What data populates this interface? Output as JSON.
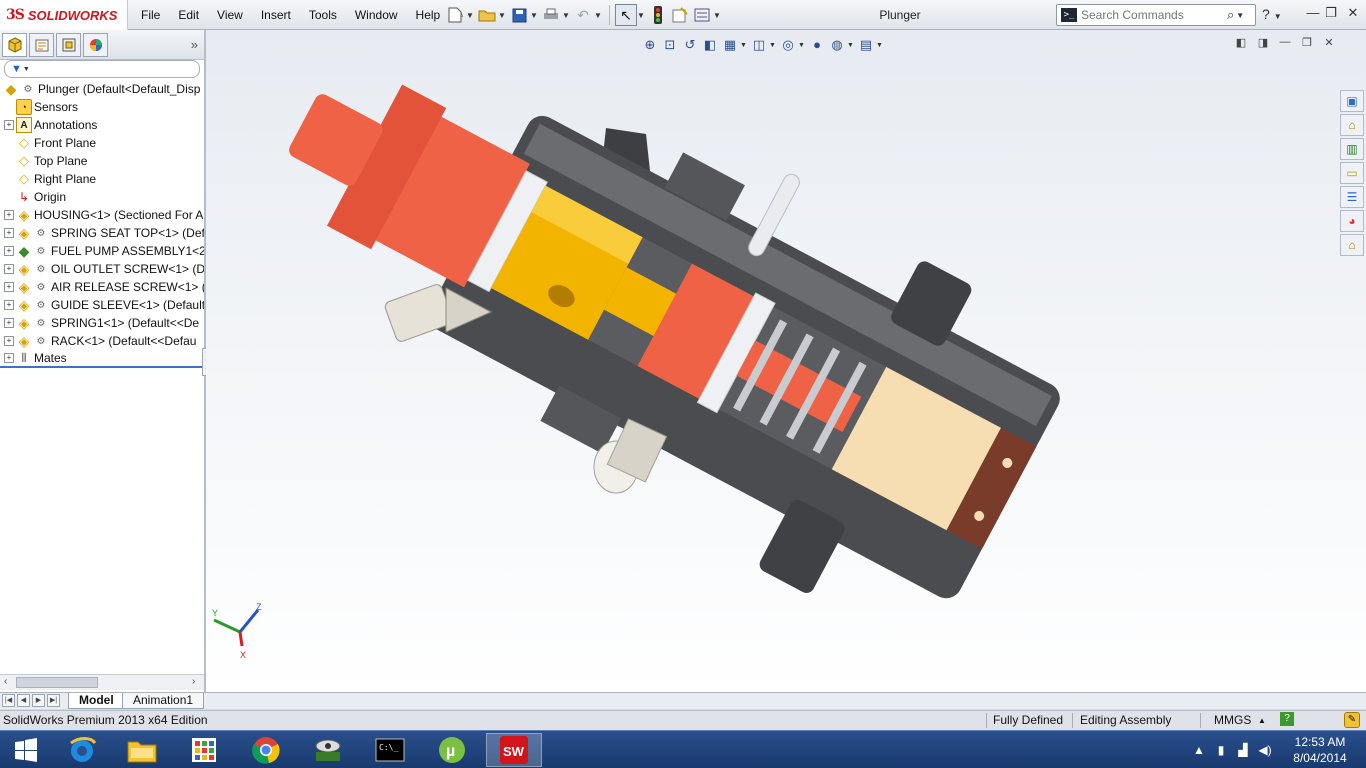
{
  "app": {
    "logo_mark": "3S",
    "logo_text": "SOLIDWORKS",
    "document_title": "Plunger"
  },
  "menus": [
    "File",
    "Edit",
    "View",
    "Insert",
    "Tools",
    "Window",
    "Help"
  ],
  "search": {
    "placeholder": "Search Commands",
    "value": ""
  },
  "feature_tree": {
    "filter_icon": "funnel-icon",
    "items": [
      {
        "label": "Plunger  (Default<Default_Disp",
        "icon": "assembly-icon",
        "level": 0
      },
      {
        "label": "Sensors",
        "icon": "sensor-icon",
        "level": 1,
        "expandable": false
      },
      {
        "label": "Annotations",
        "icon": "annotation-icon",
        "level": 1,
        "expandable": true
      },
      {
        "label": "Front Plane",
        "icon": "plane-icon",
        "level": 1,
        "expandable": false
      },
      {
        "label": "Top Plane",
        "icon": "plane-icon",
        "level": 1,
        "expandable": false
      },
      {
        "label": "Right Plane",
        "icon": "plane-icon",
        "level": 1,
        "expandable": false
      },
      {
        "label": "Origin",
        "icon": "origin-icon",
        "level": 1,
        "expandable": false
      },
      {
        "label": "HOUSING<1> (Sectioned For A",
        "icon": "part-icon",
        "level": 1,
        "expandable": true
      },
      {
        "label": "SPRING SEAT TOP<1> (Def",
        "icon": "part-icon",
        "level": 1,
        "expandable": true
      },
      {
        "label": "FUEL PUMP ASSEMBLY1<2",
        "icon": "subassembly-icon",
        "level": 1,
        "expandable": true
      },
      {
        "label": "OIL OUTLET SCREW<1> (D",
        "icon": "part-icon",
        "level": 1,
        "expandable": true
      },
      {
        "label": "AIR RELEASE SCREW<1> (D",
        "icon": "part-icon",
        "level": 1,
        "expandable": true
      },
      {
        "label": "GUIDE SLEEVE<1> (Default",
        "icon": "part-icon",
        "level": 1,
        "expandable": true
      },
      {
        "label": "SPRING1<1> (Default<<De",
        "icon": "part-icon",
        "level": 1,
        "expandable": true
      },
      {
        "label": "RACK<1> (Default<<Defau",
        "icon": "part-icon",
        "level": 1,
        "expandable": true
      },
      {
        "label": "Mates",
        "icon": "mates-icon",
        "level": 1,
        "expandable": true
      }
    ]
  },
  "bottom_tabs": [
    {
      "label": "Model",
      "active": true
    },
    {
      "label": "Animation1",
      "active": false
    }
  ],
  "status": {
    "edition": "SolidWorks Premium 2013 x64 Edition",
    "definition": "Fully Defined",
    "mode": "Editing Assembly",
    "units": "MMGS",
    "units_arrow": "▲"
  },
  "triad": {
    "x": "X",
    "y": "Y",
    "z": "Z"
  },
  "taskbar": {
    "apps": [
      "windows-start",
      "internet-explorer",
      "file-explorer",
      "metro-apps",
      "chrome",
      "network-tool",
      "command-prompt",
      "utorrent",
      "solidworks"
    ],
    "time": "12:53 AM",
    "date": "8/04/2014"
  },
  "colors": {
    "housing": "#4a4c4f",
    "red_parts": "#ef6246",
    "yellow_sleeve": "#f3b400",
    "cream_cap": "#f6ddb2",
    "rack_pin": "#e9ebee",
    "accent_red": "#d1151a"
  }
}
